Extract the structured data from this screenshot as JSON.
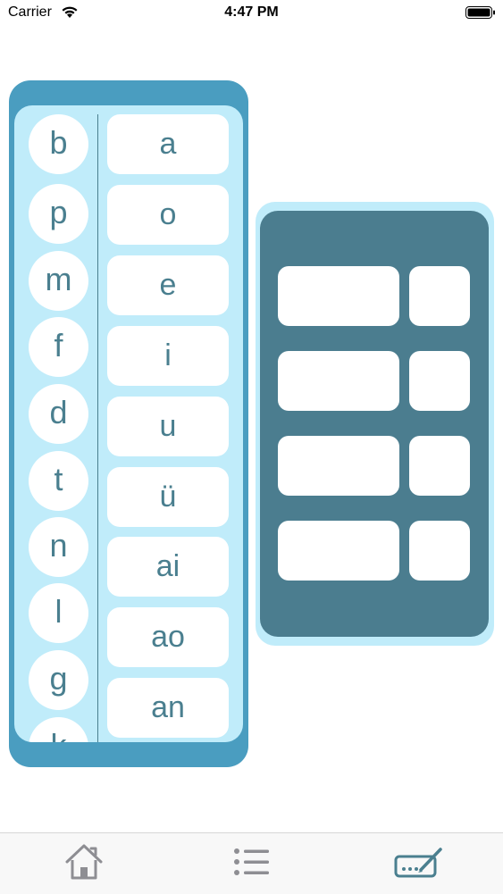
{
  "status_bar": {
    "carrier": "Carrier",
    "time": "4:47 PM"
  },
  "initials": [
    "b",
    "p",
    "m",
    "f",
    "d",
    "t",
    "n",
    "l",
    "g",
    "k"
  ],
  "finals": [
    "a",
    "o",
    "e",
    "i",
    "u",
    "ü",
    "ai",
    "ao",
    "an"
  ],
  "tab_bar": {
    "tabs": [
      {
        "icon": "home-icon",
        "active": false
      },
      {
        "icon": "list-icon",
        "active": false
      },
      {
        "icon": "pen-tablet-icon",
        "active": true
      }
    ],
    "colors": {
      "inactive": "#8e8e93",
      "active": "#4a7f8f"
    }
  },
  "colors": {
    "panel_dark_blue": "#4a9dc0",
    "panel_light_blue": "#c0ecfa",
    "answer_panel": "#4b7d8f",
    "text": "#4a7f8f"
  }
}
